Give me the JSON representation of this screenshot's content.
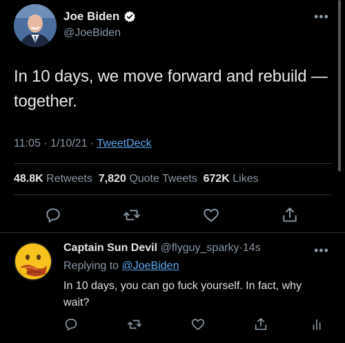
{
  "tweet": {
    "author_name": "Joe Biden",
    "author_handle": "@JoeBiden",
    "verified": true,
    "text": "In 10 days, we move forward and rebuild — together.",
    "time": "11:05",
    "date": "1/10/21",
    "separator": "·",
    "source": "TweetDeck",
    "retweets_count": "48.8K",
    "retweets_label": "Retweets",
    "quote_count": "7,820",
    "quote_label": "Quote Tweets",
    "likes_count": "672K",
    "likes_label": "Likes",
    "more_icon": "ellipsis-icon"
  },
  "reply": {
    "author_name": "Captain Sun Devil",
    "author_handle": "@flyguy_sparky",
    "separator": "·",
    "age": "14s",
    "replying_prefix": "Replying to",
    "replying_to": "@JoeBiden",
    "text": "In 10 days, you can go fuck yourself. In fact, why wait?"
  },
  "colors": {
    "background": "#000000",
    "link": "#5ea8f0",
    "muted": "#8b98a5",
    "verified": "#ffffff"
  }
}
